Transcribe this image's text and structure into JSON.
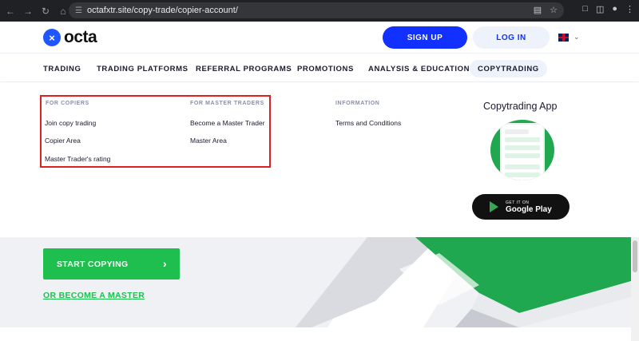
{
  "browser": {
    "url": "octafxtr.site/copy-trade/copier-account/",
    "back_icon": "arrow-left-icon",
    "forward_icon": "arrow-right-icon",
    "reload_icon": "reload-icon",
    "home_icon": "home-icon"
  },
  "header": {
    "logo_text": "octa",
    "signup_label": "SIGN UP",
    "login_label": "LOG IN"
  },
  "menu": {
    "items": [
      {
        "label": "TRADING"
      },
      {
        "label": "TRADING PLATFORMS"
      },
      {
        "label": "REFERRAL PROGRAMS"
      },
      {
        "label": "PROMOTIONS"
      },
      {
        "label": "ANALYSIS & EDUCATION"
      },
      {
        "label": "COPYTRADING"
      }
    ],
    "active": "COPYTRADING"
  },
  "dropdown": {
    "copiers": {
      "title": "FOR COPIERS",
      "links": [
        "Join copy trading",
        "Copier Area",
        "Master Trader's rating"
      ]
    },
    "masters": {
      "title": "FOR MASTER TRADERS",
      "links": [
        "Become a Master Trader",
        "Master Area"
      ]
    },
    "information": {
      "title": "INFORMATION",
      "links": [
        "Terms and Conditions"
      ]
    },
    "app": {
      "title": "Copytrading App",
      "store_small": "GET IT ON",
      "store_big": "Google Play"
    }
  },
  "hero": {
    "start_label": "START COPYING",
    "master_link": "OR BECOME A MASTER"
  },
  "colors": {
    "brand_blue": "#1230ff",
    "brand_green": "#1fbf4f",
    "highlight_red": "#e02020"
  }
}
